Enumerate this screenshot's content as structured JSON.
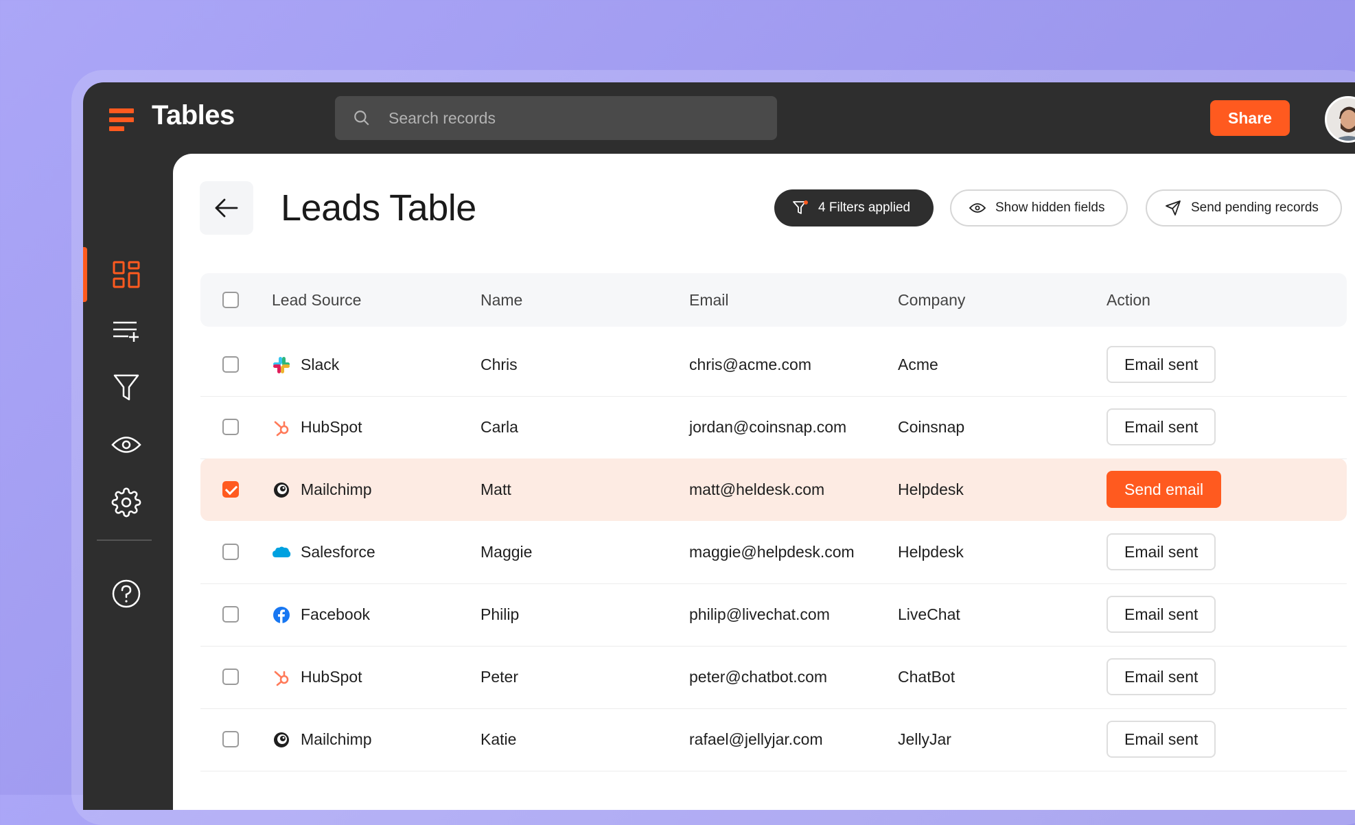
{
  "app": {
    "name": "Tables"
  },
  "search": {
    "placeholder": "Search records"
  },
  "header": {
    "share_label": "Share"
  },
  "page": {
    "title": "Leads Table"
  },
  "toolbar": {
    "filters_label": "4 Filters applied",
    "hidden_fields_label": "Show hidden fields",
    "send_pending_label": "Send pending records"
  },
  "sidebar": {
    "items": [
      {
        "name": "dashboard",
        "icon": "grid-icon",
        "active": true
      },
      {
        "name": "add-list",
        "icon": "list-add-icon",
        "active": false
      },
      {
        "name": "filter",
        "icon": "filter-icon",
        "active": false
      },
      {
        "name": "view",
        "icon": "eye-icon",
        "active": false
      },
      {
        "name": "settings",
        "icon": "gear-icon",
        "active": false
      },
      {
        "name": "help",
        "icon": "help-icon",
        "active": false
      }
    ]
  },
  "table": {
    "columns": [
      "Lead Source",
      "Name",
      "Email",
      "Company",
      "Action"
    ],
    "rows": [
      {
        "source": "Slack",
        "icon": "slack-icon",
        "name": "Chris",
        "email": "chris@acme.com",
        "company": "Acme",
        "action": "Email sent",
        "checked": false
      },
      {
        "source": "HubSpot",
        "icon": "hubspot-icon",
        "name": "Carla",
        "email": "jordan@coinsnap.com",
        "company": "Coinsnap",
        "action": "Email sent",
        "checked": false
      },
      {
        "source": "Mailchimp",
        "icon": "mailchimp-icon",
        "name": "Matt",
        "email": "matt@heldesk.com",
        "company": "Helpdesk",
        "action": "Send email",
        "checked": true
      },
      {
        "source": "Salesforce",
        "icon": "salesforce-icon",
        "name": "Maggie",
        "email": "maggie@helpdesk.com",
        "company": "Helpdesk",
        "action": "Email sent",
        "checked": false
      },
      {
        "source": "Facebook",
        "icon": "facebook-icon",
        "name": "Philip",
        "email": "philip@livechat.com",
        "company": "LiveChat",
        "action": "Email sent",
        "checked": false
      },
      {
        "source": "HubSpot",
        "icon": "hubspot-icon",
        "name": "Peter",
        "email": "peter@chatbot.com",
        "company": "ChatBot",
        "action": "Email sent",
        "checked": false
      },
      {
        "source": "Mailchimp",
        "icon": "mailchimp-icon",
        "name": "Katie",
        "email": "rafael@jellyjar.com",
        "company": "JellyJar",
        "action": "Email sent",
        "checked": false
      }
    ]
  },
  "colors": {
    "accent": "#ff5a1f",
    "dark": "#2e2e2e",
    "selected_row": "#fdebe3"
  }
}
